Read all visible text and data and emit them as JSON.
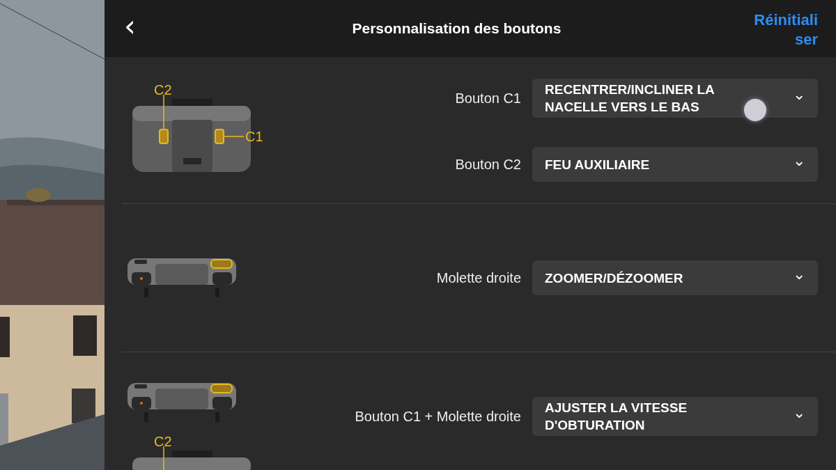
{
  "header": {
    "back": "‹",
    "title": "Personnalisation des boutons",
    "reset": "Réinitialiser"
  },
  "sections": [
    {
      "images": [
        {
          "kind": "back",
          "labels": [
            "C2",
            "C1"
          ]
        }
      ],
      "rows": [
        {
          "label": "Bouton C1",
          "value": "RECENTRER/INCLINER LA NACELLE VERS LE BAS",
          "chevron": "⌄"
        },
        {
          "label": "Bouton C2",
          "value": "FEU AUXILIAIRE",
          "chevron": "⌄"
        }
      ]
    },
    {
      "images": [
        {
          "kind": "top"
        }
      ],
      "rows": [
        {
          "label": "Molette droite",
          "value": "ZOOMER/DÉZOOMER",
          "chevron": "⌄"
        }
      ]
    },
    {
      "images": [
        {
          "kind": "top"
        },
        {
          "kind": "back",
          "labels": [
            "C2"
          ]
        }
      ],
      "rows": [
        {
          "label": "Bouton C1 + Molette droite",
          "value": "AJUSTER LA VITESSE D'OBTURATION",
          "chevron": "⌄"
        }
      ]
    }
  ]
}
